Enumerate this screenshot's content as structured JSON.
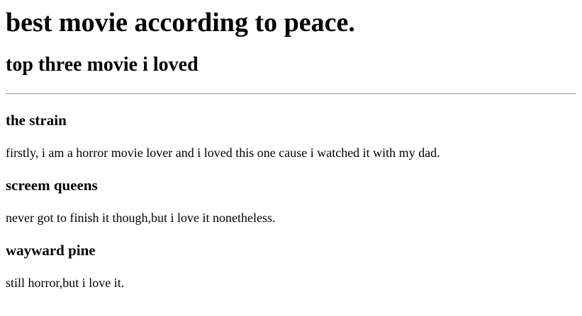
{
  "page": {
    "title": "best movie according to peace.",
    "subtitle": "top three movie i loved"
  },
  "movies": [
    {
      "title": "the strain",
      "text": "firstly, i am a horror movie lover and i loved this one cause i watched it with my dad."
    },
    {
      "title": "screem queens",
      "text": "never got to finish it though,but i love it nonetheless."
    },
    {
      "title": "wayward pine",
      "text": "still horror,but i love it."
    }
  ]
}
